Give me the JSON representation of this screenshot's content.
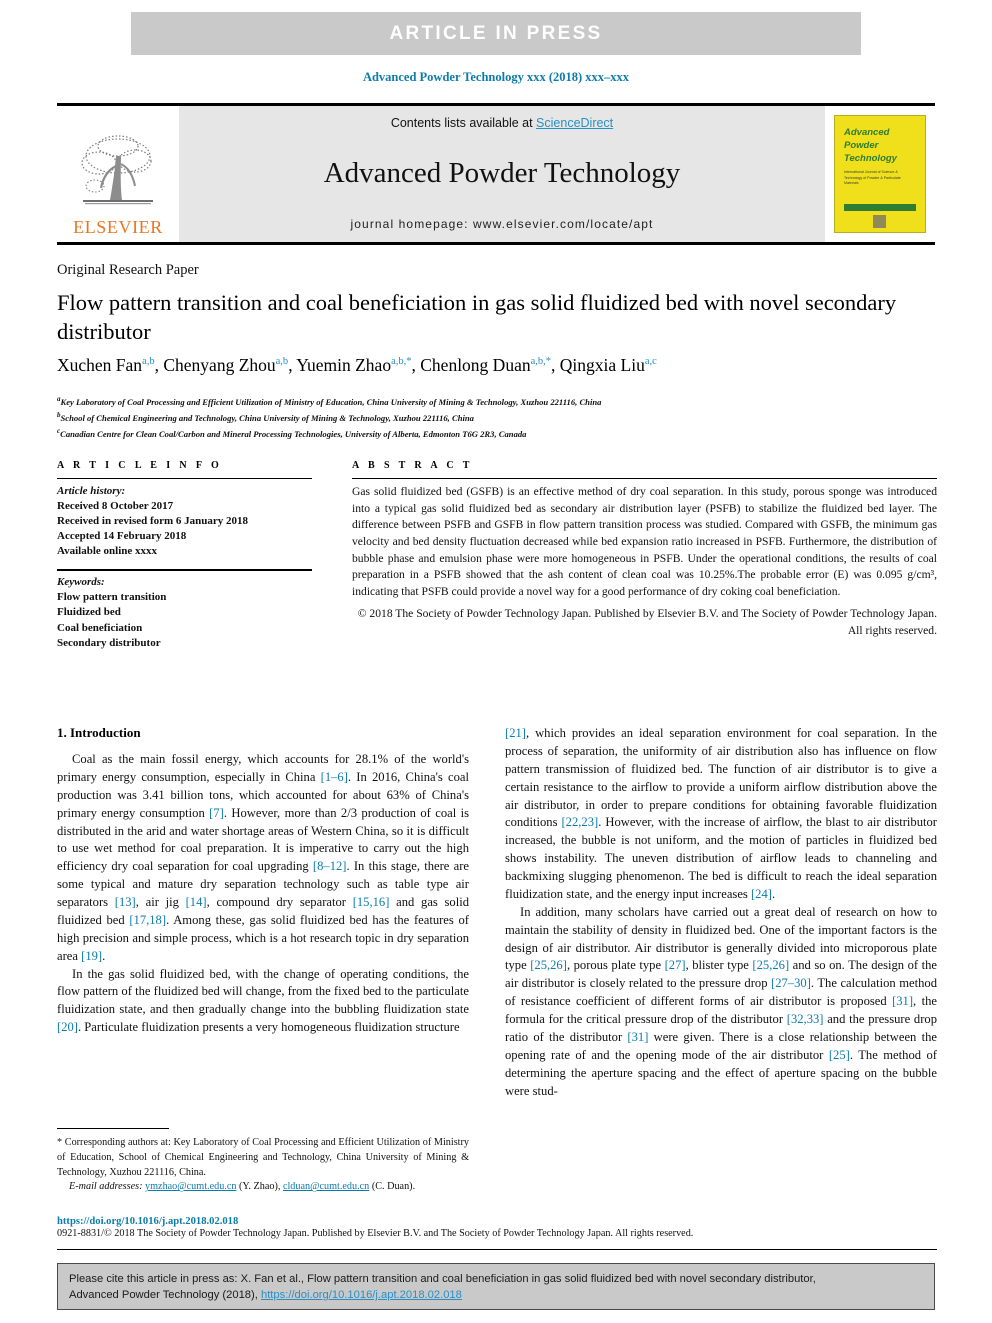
{
  "banner": {
    "text": "ARTICLE  IN  PRESS"
  },
  "running_head": {
    "text": "Advanced Powder Technology xxx (2018) xxx–xxx"
  },
  "masthead": {
    "publisher": "ELSEVIER",
    "contents_prefix": "Contents lists available at ",
    "sciencedirect": "ScienceDirect",
    "journal_title": "Advanced Powder Technology",
    "homepage": "journal homepage: www.elsevier.com/locate/apt",
    "cover": {
      "line1": "Advanced",
      "line2": "Powder",
      "line3": "Technology",
      "subtitle": "International Journal of Science & Technology of Powder & Particulate Materials"
    }
  },
  "article": {
    "type": "Original Research Paper",
    "title": "Flow pattern transition and coal beneficiation in gas solid fluidized bed with novel secondary distributor",
    "authors": [
      {
        "name": "Xuchen Fan",
        "marks": "a,b",
        "sep": ", "
      },
      {
        "name": "Chenyang Zhou",
        "marks": "a,b",
        "sep": ", "
      },
      {
        "name": "Yuemin Zhao",
        "marks": "a,b,*",
        "sep": ", "
      },
      {
        "name": "Chenlong Duan",
        "marks": "a,b,*",
        "sep": ", "
      },
      {
        "name": "Qingxia Liu",
        "marks": "a,c",
        "sep": ""
      }
    ],
    "affiliations": [
      {
        "mark": "a",
        "text": "Key Laboratory of Coal Processing and Efficient Utilization of Ministry of Education, China University of Mining & Technology, Xuzhou 221116, China"
      },
      {
        "mark": "b",
        "text": "School of Chemical Engineering and Technology, China University of Mining & Technology, Xuzhou 221116, China"
      },
      {
        "mark": "c",
        "text": "Canadian Centre for Clean Coal/Carbon and Mineral Processing Technologies, University of Alberta, Edmonton T6G 2R3, Canada"
      }
    ]
  },
  "article_info": {
    "label": "A R T I C L E    I N F O",
    "history_label": "Article history:",
    "history": [
      "Received 8 October 2017",
      "Received in revised form 6 January 2018",
      "Accepted 14 February 2018",
      "Available online xxxx"
    ],
    "keywords_label": "Keywords:",
    "keywords": [
      "Flow pattern transition",
      "Fluidized bed",
      "Coal beneficiation",
      "Secondary distributor"
    ]
  },
  "abstract": {
    "label": "A B S T R A C T",
    "body": "Gas solid fluidized bed (GSFB) is an effective method of dry coal separation. In this study, porous sponge was introduced into a typical gas solid fluidized bed as secondary air distribution layer (PSFB) to stabilize the fluidized bed layer. The difference between PSFB and GSFB in flow pattern transition process was studied. Compared with GSFB, the minimum gas velocity and bed density fluctuation decreased while bed expansion ratio increased in PSFB. Furthermore, the distribution of bubble phase and emulsion phase were more homogeneous in PSFB. Under the operational conditions, the results of coal preparation in a PSFB showed that the ash content of clean coal was 10.25%.The probable error (E) was 0.095 g/cm³, indicating that PSFB could provide a novel way for a good performance of dry coking coal beneficiation.",
    "copyright": "© 2018 The Society of Powder Technology Japan. Published by Elsevier B.V. and The Society of Powder Technology Japan. All rights reserved."
  },
  "introduction": {
    "heading": "1. Introduction",
    "left_paragraphs": [
      "Coal as the main fossil energy, which accounts for 28.1% of the world's primary energy consumption, especially in China [1–6]. In 2016, China's coal production was 3.41 billion tons, which accounted for about 63% of China's primary energy consumption [7]. However, more than 2/3 production of coal is distributed in the arid and water shortage areas of Western China, so it is difficult to use wet method for coal preparation. It is imperative to carry out the high efficiency dry coal separation for coal upgrading [8–12]. In this stage, there are some typical and mature dry separation technology such as table type air separators [13], air jig [14], compound dry separator [15,16] and gas solid fluidized bed [17,18]. Among these, gas solid fluidized bed has the features of high precision and simple process, which is a hot research topic in dry separation area [19].",
      "In the gas solid fluidized bed, with the change of operating conditions, the flow pattern of the fluidized bed will change, from the fixed bed to the particulate fluidization state, and then gradually change into the bubbling fluidization state [20]. Particulate fluidization presents a very homogeneous fluidization structure"
    ],
    "right_paragraphs": [
      "[21], which provides an ideal separation environment for coal separation. In the process of separation, the uniformity of air distribution also has influence on flow pattern transmission of fluidized bed. The function of air distributor is to give a certain resistance to the airflow to provide a uniform airflow distribution above the air distributor, in order to prepare conditions for obtaining favorable fluidization conditions [22,23]. However, with the increase of airflow, the blast to air distributor increased, the bubble is not uniform, and the motion of particles in fluidized bed shows instability. The uneven distribution of airflow leads to channeling and backmixing slugging phenomenon. The bed is difficult to reach the ideal separation fluidization state, and the energy input increases [24].",
      "In addition, many scholars have carried out a great deal of research on how to maintain the stability of density in fluidized bed. One of the important factors is the design of air distributor. Air distributor is generally divided into microporous plate type [25,26], porous plate type [27], blister type [25,26] and so on. The design of the air distributor is closely related to the pressure drop [27–30]. The calculation method of resistance coefficient of different forms of air distributor is proposed [31], the formula for the critical pressure drop of the distributor [32,33] and the pressure drop ratio of the distributor [31] were given. There is a close relationship between the opening rate of and the opening mode of the air distributor [25]. The method of determining the aperture spacing and the effect of aperture spacing on the bubble were stud-"
    ]
  },
  "footnote": {
    "corresponding": "* Corresponding authors at: Key Laboratory of Coal Processing and Efficient Utilization of Ministry of Education, School of Chemical Engineering and Technology, China University of Mining & Technology, Xuzhou 221116, China.",
    "email_label": "E-mail addresses:",
    "email1": "ymzhao@cumt.edu.cn",
    "email1_owner": "(Y. Zhao),",
    "email2": "clduan@cumt.edu.cn",
    "email2_owner": "(C. Duan)."
  },
  "doi_block": {
    "doi": "https://doi.org/10.1016/j.apt.2018.02.018",
    "issn_line": "0921-8831/© 2018 The Society of Powder Technology Japan. Published by Elsevier B.V. and The Society of Powder Technology Japan. All rights reserved."
  },
  "cite_box": {
    "line1": "Please cite this article in press as: X. Fan et al., Flow pattern transition and coal beneficiation in gas solid fluidized bed with novel secondary distributor,",
    "line2_prefix": "Advanced Powder Technology (2018), ",
    "line2_link": "https://doi.org/10.1016/j.apt.2018.02.018"
  },
  "colors": {
    "link": "#0d7bab",
    "banner_bg": "#c9c9c9",
    "elsevier_orange": "#e87722",
    "cover_yellow": "#f0e01c",
    "cover_green": "#2e7d32"
  }
}
